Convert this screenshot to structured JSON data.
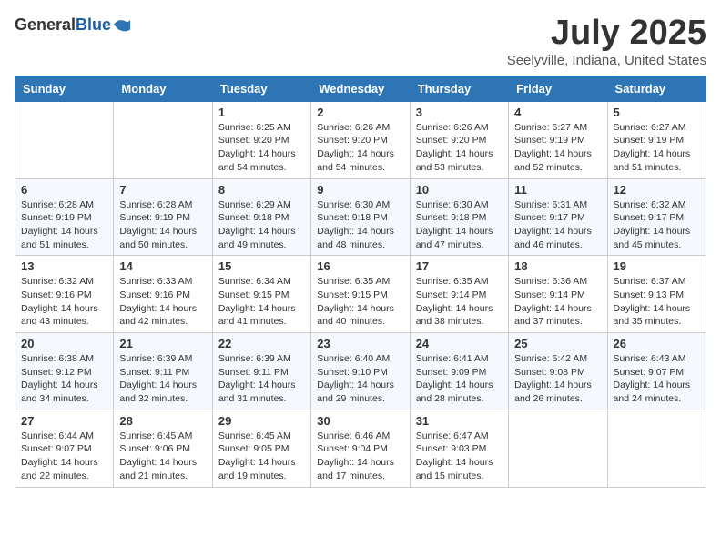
{
  "header": {
    "logo_general": "General",
    "logo_blue": "Blue",
    "month_title": "July 2025",
    "location": "Seelyville, Indiana, United States"
  },
  "weekdays": [
    "Sunday",
    "Monday",
    "Tuesday",
    "Wednesday",
    "Thursday",
    "Friday",
    "Saturday"
  ],
  "weeks": [
    [
      {
        "day": "",
        "sunrise": "",
        "sunset": "",
        "daylight": ""
      },
      {
        "day": "",
        "sunrise": "",
        "sunset": "",
        "daylight": ""
      },
      {
        "day": "1",
        "sunrise": "Sunrise: 6:25 AM",
        "sunset": "Sunset: 9:20 PM",
        "daylight": "Daylight: 14 hours and 54 minutes."
      },
      {
        "day": "2",
        "sunrise": "Sunrise: 6:26 AM",
        "sunset": "Sunset: 9:20 PM",
        "daylight": "Daylight: 14 hours and 54 minutes."
      },
      {
        "day": "3",
        "sunrise": "Sunrise: 6:26 AM",
        "sunset": "Sunset: 9:20 PM",
        "daylight": "Daylight: 14 hours and 53 minutes."
      },
      {
        "day": "4",
        "sunrise": "Sunrise: 6:27 AM",
        "sunset": "Sunset: 9:19 PM",
        "daylight": "Daylight: 14 hours and 52 minutes."
      },
      {
        "day": "5",
        "sunrise": "Sunrise: 6:27 AM",
        "sunset": "Sunset: 9:19 PM",
        "daylight": "Daylight: 14 hours and 51 minutes."
      }
    ],
    [
      {
        "day": "6",
        "sunrise": "Sunrise: 6:28 AM",
        "sunset": "Sunset: 9:19 PM",
        "daylight": "Daylight: 14 hours and 51 minutes."
      },
      {
        "day": "7",
        "sunrise": "Sunrise: 6:28 AM",
        "sunset": "Sunset: 9:19 PM",
        "daylight": "Daylight: 14 hours and 50 minutes."
      },
      {
        "day": "8",
        "sunrise": "Sunrise: 6:29 AM",
        "sunset": "Sunset: 9:18 PM",
        "daylight": "Daylight: 14 hours and 49 minutes."
      },
      {
        "day": "9",
        "sunrise": "Sunrise: 6:30 AM",
        "sunset": "Sunset: 9:18 PM",
        "daylight": "Daylight: 14 hours and 48 minutes."
      },
      {
        "day": "10",
        "sunrise": "Sunrise: 6:30 AM",
        "sunset": "Sunset: 9:18 PM",
        "daylight": "Daylight: 14 hours and 47 minutes."
      },
      {
        "day": "11",
        "sunrise": "Sunrise: 6:31 AM",
        "sunset": "Sunset: 9:17 PM",
        "daylight": "Daylight: 14 hours and 46 minutes."
      },
      {
        "day": "12",
        "sunrise": "Sunrise: 6:32 AM",
        "sunset": "Sunset: 9:17 PM",
        "daylight": "Daylight: 14 hours and 45 minutes."
      }
    ],
    [
      {
        "day": "13",
        "sunrise": "Sunrise: 6:32 AM",
        "sunset": "Sunset: 9:16 PM",
        "daylight": "Daylight: 14 hours and 43 minutes."
      },
      {
        "day": "14",
        "sunrise": "Sunrise: 6:33 AM",
        "sunset": "Sunset: 9:16 PM",
        "daylight": "Daylight: 14 hours and 42 minutes."
      },
      {
        "day": "15",
        "sunrise": "Sunrise: 6:34 AM",
        "sunset": "Sunset: 9:15 PM",
        "daylight": "Daylight: 14 hours and 41 minutes."
      },
      {
        "day": "16",
        "sunrise": "Sunrise: 6:35 AM",
        "sunset": "Sunset: 9:15 PM",
        "daylight": "Daylight: 14 hours and 40 minutes."
      },
      {
        "day": "17",
        "sunrise": "Sunrise: 6:35 AM",
        "sunset": "Sunset: 9:14 PM",
        "daylight": "Daylight: 14 hours and 38 minutes."
      },
      {
        "day": "18",
        "sunrise": "Sunrise: 6:36 AM",
        "sunset": "Sunset: 9:14 PM",
        "daylight": "Daylight: 14 hours and 37 minutes."
      },
      {
        "day": "19",
        "sunrise": "Sunrise: 6:37 AM",
        "sunset": "Sunset: 9:13 PM",
        "daylight": "Daylight: 14 hours and 35 minutes."
      }
    ],
    [
      {
        "day": "20",
        "sunrise": "Sunrise: 6:38 AM",
        "sunset": "Sunset: 9:12 PM",
        "daylight": "Daylight: 14 hours and 34 minutes."
      },
      {
        "day": "21",
        "sunrise": "Sunrise: 6:39 AM",
        "sunset": "Sunset: 9:11 PM",
        "daylight": "Daylight: 14 hours and 32 minutes."
      },
      {
        "day": "22",
        "sunrise": "Sunrise: 6:39 AM",
        "sunset": "Sunset: 9:11 PM",
        "daylight": "Daylight: 14 hours and 31 minutes."
      },
      {
        "day": "23",
        "sunrise": "Sunrise: 6:40 AM",
        "sunset": "Sunset: 9:10 PM",
        "daylight": "Daylight: 14 hours and 29 minutes."
      },
      {
        "day": "24",
        "sunrise": "Sunrise: 6:41 AM",
        "sunset": "Sunset: 9:09 PM",
        "daylight": "Daylight: 14 hours and 28 minutes."
      },
      {
        "day": "25",
        "sunrise": "Sunrise: 6:42 AM",
        "sunset": "Sunset: 9:08 PM",
        "daylight": "Daylight: 14 hours and 26 minutes."
      },
      {
        "day": "26",
        "sunrise": "Sunrise: 6:43 AM",
        "sunset": "Sunset: 9:07 PM",
        "daylight": "Daylight: 14 hours and 24 minutes."
      }
    ],
    [
      {
        "day": "27",
        "sunrise": "Sunrise: 6:44 AM",
        "sunset": "Sunset: 9:07 PM",
        "daylight": "Daylight: 14 hours and 22 minutes."
      },
      {
        "day": "28",
        "sunrise": "Sunrise: 6:45 AM",
        "sunset": "Sunset: 9:06 PM",
        "daylight": "Daylight: 14 hours and 21 minutes."
      },
      {
        "day": "29",
        "sunrise": "Sunrise: 6:45 AM",
        "sunset": "Sunset: 9:05 PM",
        "daylight": "Daylight: 14 hours and 19 minutes."
      },
      {
        "day": "30",
        "sunrise": "Sunrise: 6:46 AM",
        "sunset": "Sunset: 9:04 PM",
        "daylight": "Daylight: 14 hours and 17 minutes."
      },
      {
        "day": "31",
        "sunrise": "Sunrise: 6:47 AM",
        "sunset": "Sunset: 9:03 PM",
        "daylight": "Daylight: 14 hours and 15 minutes."
      },
      {
        "day": "",
        "sunrise": "",
        "sunset": "",
        "daylight": ""
      },
      {
        "day": "",
        "sunrise": "",
        "sunset": "",
        "daylight": ""
      }
    ]
  ]
}
